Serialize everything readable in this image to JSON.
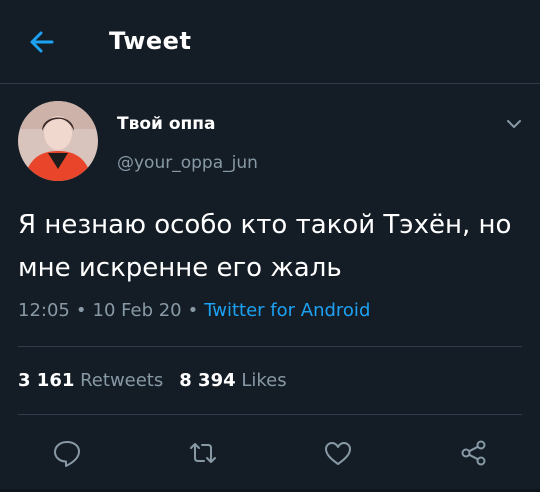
{
  "header": {
    "title": "Tweet",
    "back_icon": "arrow-left-icon"
  },
  "tweet": {
    "author_name": "Твой оппа",
    "author_handle": "@your_oppa_jun",
    "text": "Я незнаю особо кто такой Тэхён, но мне искренне его жаль",
    "time": "12:05",
    "date": "10 Feb 20",
    "separator": "•",
    "source": "Twitter for Android",
    "retweets_count": "3 161",
    "retweets_label": "Retweets",
    "likes_count": "8 394",
    "likes_label": "Likes"
  },
  "actions": {
    "reply_icon": "reply-icon",
    "retweet_icon": "retweet-icon",
    "like_icon": "heart-icon",
    "share_icon": "share-icon"
  },
  "colors": {
    "background": "#141d26",
    "text": "#ffffff",
    "secondary_text": "#8899a6",
    "accent": "#1da1f2",
    "divider": "#2f3d4c"
  }
}
